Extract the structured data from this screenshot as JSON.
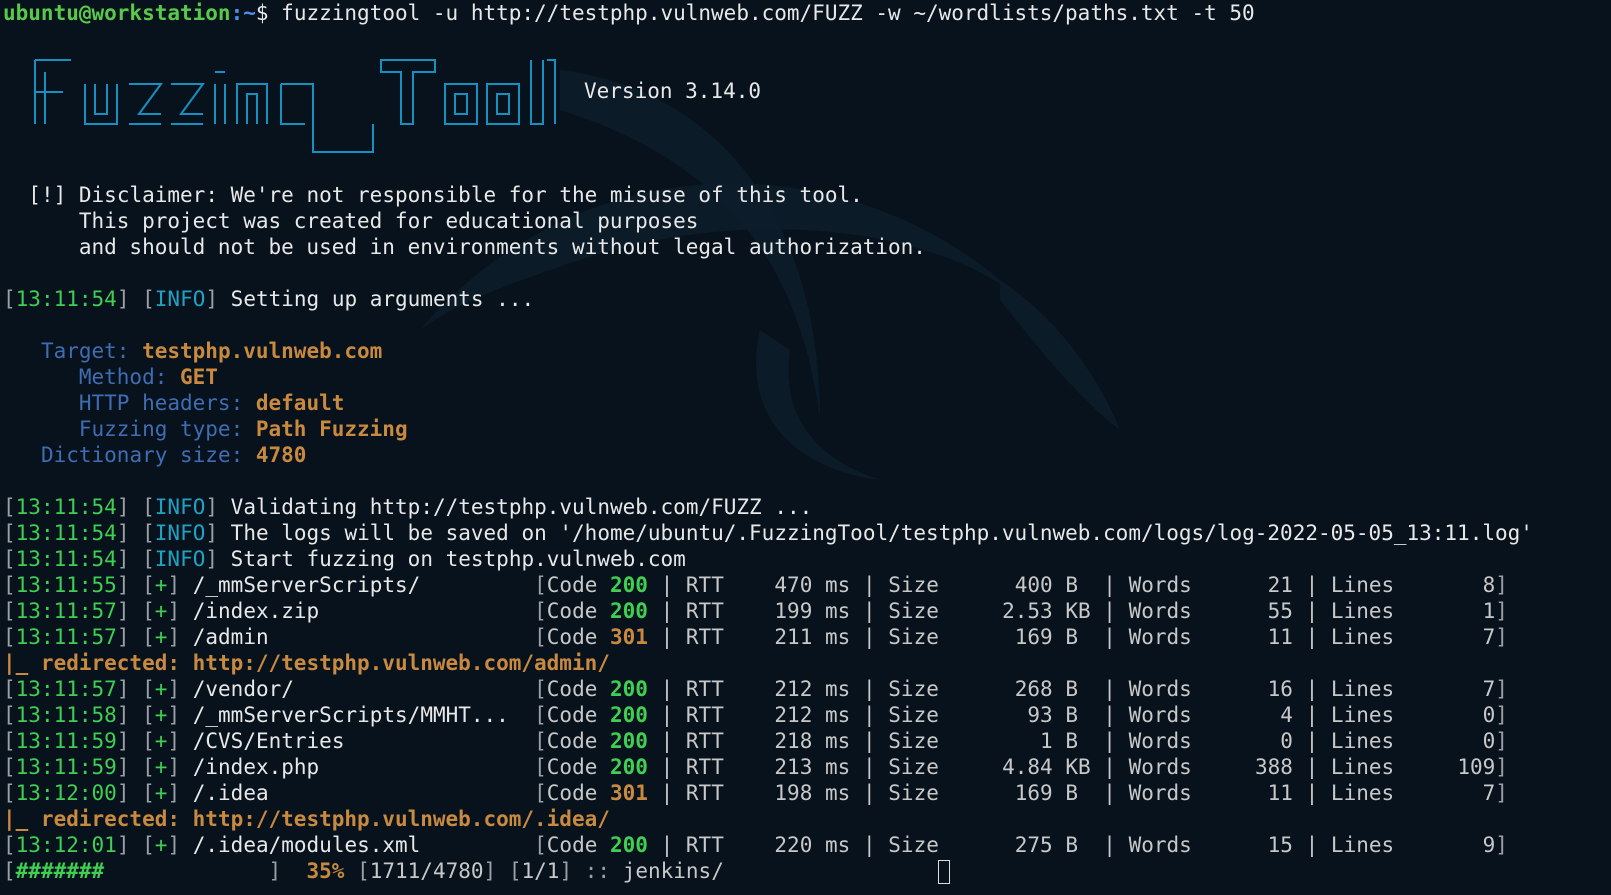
{
  "prompt": {
    "user_host": "ubuntu@workstation",
    "path": ":~",
    "symbol": "$ ",
    "command": "fuzzingtool -u http://testphp.vulnweb.com/FUZZ -w ~/wordlists/paths.txt -t 50"
  },
  "banner": {
    "lines": [
      "  _____                 _____       _ ",
      " |  ___|_ _ ____ ____ _ ____ ____  |_   _|_ ____| | ",
      " |  __| | |- _|- _|'|   | . |  | | . | . | | ",
      " |_|  |___|___|___|_|_|_|_  |  |_|___|___|_| ",
      "                        |___| "
    ],
    "version": "Version 3.14.0"
  },
  "disclaimer": {
    "tag": "[!]",
    "line1": "Disclaimer: We're not responsible for the misuse of this tool.",
    "line2": "This project was created for educational purposes",
    "line3": "and should not be used in environments without legal authorization."
  },
  "setup": {
    "time": "13:11:54",
    "level": "INFO",
    "msg": "Setting up arguments ..."
  },
  "config": {
    "target_label": "Target: ",
    "target": "testphp.vulnweb.com",
    "method_label": "Method: ",
    "method": "GET",
    "headers_label": "HTTP headers: ",
    "headers": "default",
    "type_label": "Fuzzing type: ",
    "type": "Path Fuzzing",
    "dict_label": "Dictionary size: ",
    "dict": "4780"
  },
  "info": [
    {
      "time": "13:11:54",
      "level": "INFO",
      "msg": "Validating http://testphp.vulnweb.com/FUZZ ..."
    },
    {
      "time": "13:11:54",
      "level": "INFO",
      "msg": "The logs will be saved on '/home/ubuntu/.FuzzingTool/testphp.vulnweb.com/logs/log-2022-05-05_13:11.log'"
    },
    {
      "time": "13:11:54",
      "level": "INFO",
      "msg": "Start fuzzing on testphp.vulnweb.com"
    }
  ],
  "results": [
    {
      "time": "13:11:55",
      "path": "/_mmServerScripts/",
      "code": "200",
      "rtt": "470",
      "size": "400",
      "unit": "B ",
      "words": "21",
      "lines": "8"
    },
    {
      "time": "13:11:57",
      "path": "/index.zip",
      "code": "200",
      "rtt": "199",
      "size": "2.53",
      "unit": "KB",
      "words": "55",
      "lines": "1"
    },
    {
      "time": "13:11:57",
      "path": "/admin",
      "code": "301",
      "rtt": "211",
      "size": "169",
      "unit": "B ",
      "words": "11",
      "lines": "7",
      "redirect": "http://testphp.vulnweb.com/admin/"
    },
    {
      "time": "13:11:57",
      "path": "/vendor/",
      "code": "200",
      "rtt": "212",
      "size": "268",
      "unit": "B ",
      "words": "16",
      "lines": "7"
    },
    {
      "time": "13:11:58",
      "path": "/_mmServerScripts/MMHT...",
      "code": "200",
      "rtt": "212",
      "size": "93",
      "unit": "B ",
      "words": "4",
      "lines": "0"
    },
    {
      "time": "13:11:59",
      "path": "/CVS/Entries",
      "code": "200",
      "rtt": "218",
      "size": "1",
      "unit": "B ",
      "words": "0",
      "lines": "0"
    },
    {
      "time": "13:11:59",
      "path": "/index.php",
      "code": "200",
      "rtt": "213",
      "size": "4.84",
      "unit": "KB",
      "words": "388",
      "lines": "109"
    },
    {
      "time": "13:12:00",
      "path": "/.idea",
      "code": "301",
      "rtt": "198",
      "size": "169",
      "unit": "B ",
      "words": "11",
      "lines": "7",
      "redirect": "http://testphp.vulnweb.com/.idea/"
    },
    {
      "time": "13:12:01",
      "path": "/.idea/modules.xml",
      "code": "200",
      "rtt": "220",
      "size": "275",
      "unit": "B ",
      "words": "15",
      "lines": "9"
    }
  ],
  "labels": {
    "plus": "[+]",
    "code": "Code ",
    "rtt": "RTT",
    "ms": "ms",
    "size": "Size",
    "words": "Words",
    "lines": "Lines",
    "redirected": "|_ redirected: "
  },
  "progress": {
    "bar": "#######",
    "percent": "35%",
    "count": "1711/4780",
    "jobs": "1/1",
    "current": "jenkins/"
  },
  "colors": {
    "background": "#07121c",
    "ok_code": "#3fcf52",
    "redirect_code": "#c98a3f",
    "timestamp": "#3fcf52",
    "info": "#1fa3c4"
  }
}
